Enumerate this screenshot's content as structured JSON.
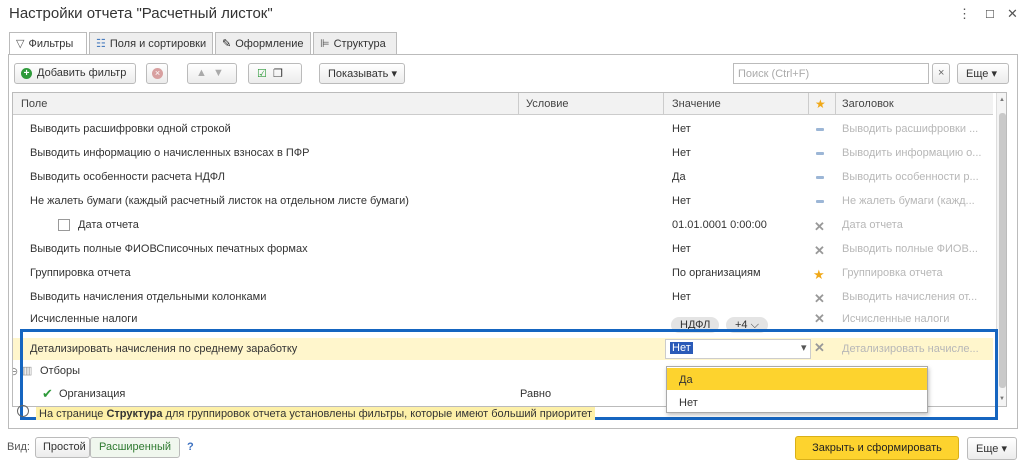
{
  "window": {
    "title": "Настройки отчета \"Расчетный листок\"",
    "more_glyph": "⋮",
    "max_glyph": "☐",
    "close_glyph": "✕"
  },
  "tabs": [
    {
      "label": "Фильтры",
      "icon": "filter-icon",
      "glyph": "▽"
    },
    {
      "label": "Поля и сортировки",
      "icon": "fields-icon",
      "glyph": "☷"
    },
    {
      "label": "Оформление",
      "icon": "brush-icon",
      "glyph": "✎"
    },
    {
      "label": "Структура",
      "icon": "structure-icon",
      "glyph": "⊫"
    }
  ],
  "toolbar": {
    "add_filter": "Добавить фильтр",
    "show": "Показывать",
    "search_placeholder": "Поиск (Ctrl+F)",
    "clear_glyph": "×",
    "more": "Еще"
  },
  "grid": {
    "columns": {
      "field": "Поле",
      "condition": "Условие",
      "value": "Значение",
      "header": "Заголовок",
      "star_glyph": "★"
    },
    "rows": [
      {
        "field": "Выводить расшифровки одной строкой",
        "value": "Нет",
        "header": "Выводить расшифровки ..."
      },
      {
        "field": "Выводить информацию о начисленных взносах в ПФР",
        "value": "Нет",
        "header": "Выводить информацию о..."
      },
      {
        "field": "Выводить особенности расчета НДФЛ",
        "value": "Да",
        "header": "Выводить особенности р..."
      },
      {
        "field": "Не жалеть бумаги (каждый расчетный листок на отдельном листе бумаги)",
        "value": "Нет",
        "header": "Не жалеть бумаги (кажд..."
      },
      {
        "field": "Дата отчета",
        "value": "01.01.0001 0:00:00",
        "header": "Дата отчета"
      },
      {
        "field": "Выводить полные ФИОВСписочных печатных формах",
        "value": "Нет",
        "header": "Выводить полные ФИОВ..."
      },
      {
        "field": "Группировка отчета",
        "value": "По организациям",
        "header": "Группировка отчета"
      },
      {
        "field": "Выводить начисления отдельными колонками",
        "value": "Нет",
        "header": "Выводить начисления от..."
      },
      {
        "field": "Исчисленные налоги",
        "value": "НДФЛ",
        "value_more": "+4",
        "header": "Исчисленные налоги"
      },
      {
        "field": "Детализировать начисления по среднему заработку",
        "value": "Нет",
        "header": "Детализировать начисле..."
      }
    ],
    "group": {
      "label": "Отборы"
    },
    "sub_row": {
      "field": "Организация",
      "condition": "Равно"
    }
  },
  "dropdown": {
    "options": [
      "Да",
      "Нет"
    ]
  },
  "info": {
    "before": "На странице ",
    "link": "Структура",
    "after": " для группировок отчета установлены фильтры, которые имеют больший приоритет"
  },
  "footer": {
    "view_label": "Вид:",
    "simple": "Простой",
    "extended": "Расширенный",
    "help": "?",
    "close_and_build": "Закрыть и сформировать",
    "more": "Еще"
  }
}
